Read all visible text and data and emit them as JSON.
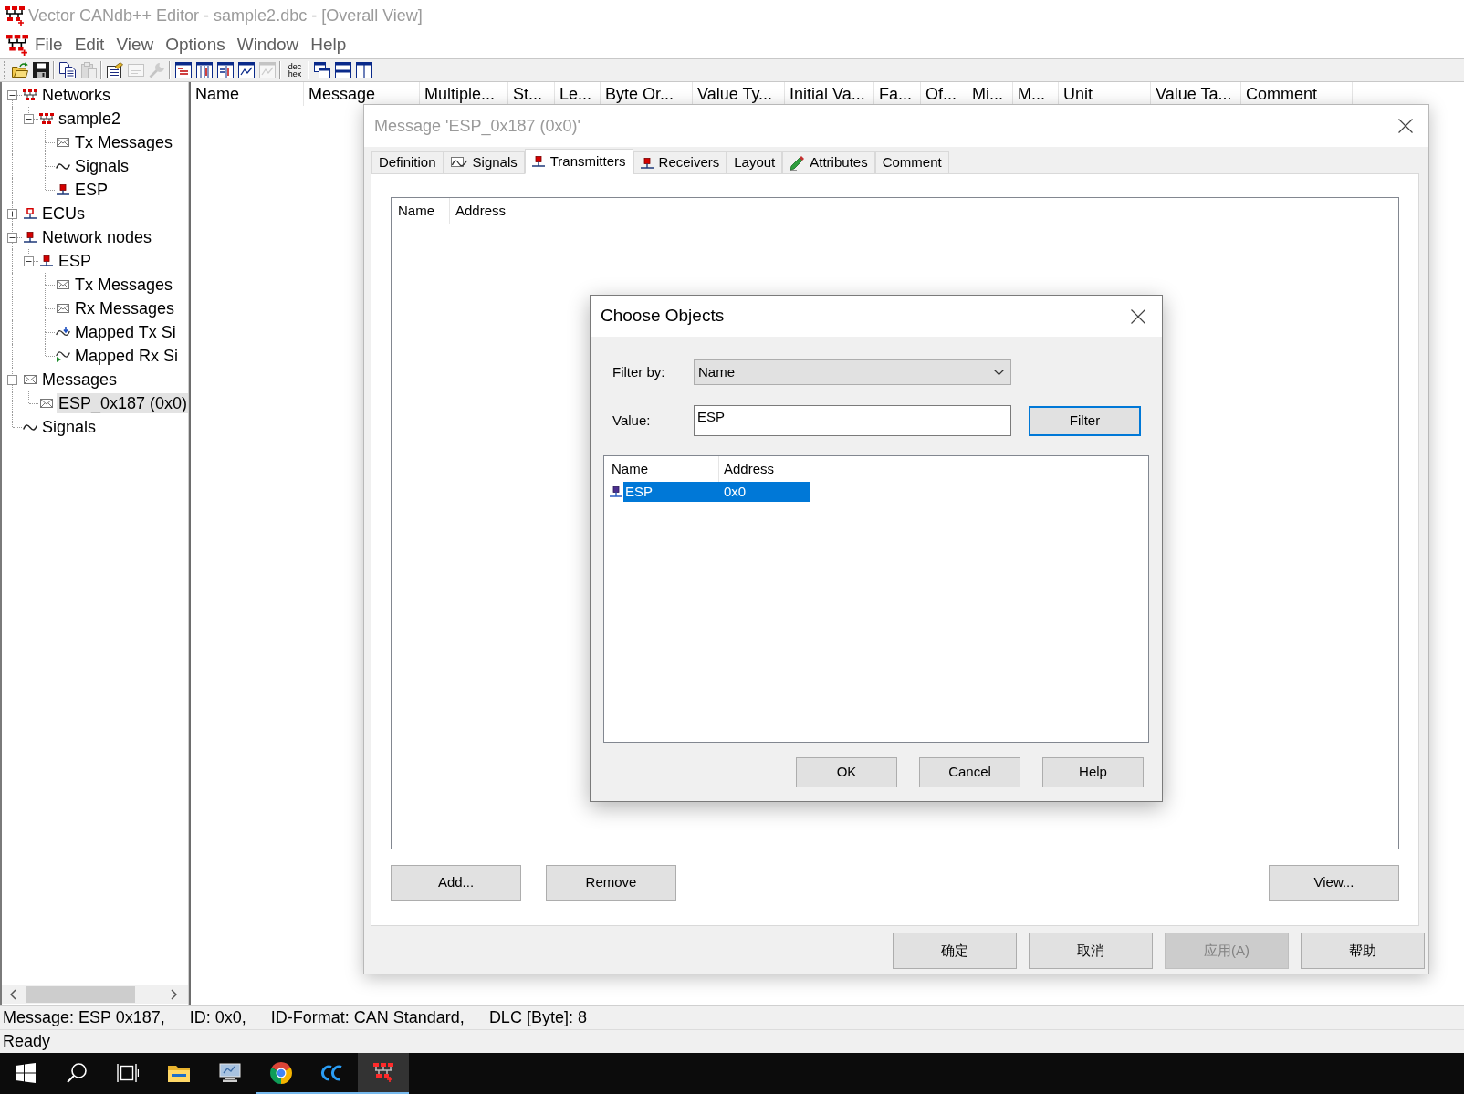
{
  "window": {
    "title": "Vector CANdb++ Editor - sample2.dbc - [Overall View]"
  },
  "menu": [
    "File",
    "Edit",
    "View",
    "Options",
    "Window",
    "Help"
  ],
  "toolbar": [
    [
      {
        "kind": "open",
        "disabled": false
      },
      {
        "kind": "save",
        "disabled": false
      }
    ],
    [
      {
        "kind": "copy",
        "disabled": false
      },
      {
        "kind": "paste",
        "disabled": true
      }
    ],
    [
      {
        "kind": "properties",
        "disabled": false
      },
      {
        "kind": "form",
        "disabled": true
      },
      {
        "kind": "wrench",
        "disabled": true
      }
    ],
    [
      {
        "kind": "view-list",
        "disabled": false
      },
      {
        "kind": "view-columns",
        "disabled": false
      },
      {
        "kind": "view-split",
        "disabled": false
      },
      {
        "kind": "view-chart",
        "disabled": false
      },
      {
        "kind": "view-image",
        "disabled": true
      }
    ],
    [
      {
        "kind": "radix",
        "labels": [
          "dec",
          "hex"
        ],
        "disabled": false
      }
    ],
    [
      {
        "kind": "cascade",
        "disabled": false
      },
      {
        "kind": "tile-horizontal",
        "disabled": false
      },
      {
        "kind": "tile-vertical",
        "disabled": false
      }
    ]
  ],
  "tree": [
    {
      "label": "Networks",
      "kind": "network",
      "expanded": true,
      "selected": false,
      "children": [
        {
          "label": "sample2",
          "kind": "network",
          "expanded": true,
          "selected": false,
          "children": [
            {
              "label": "Tx Messages",
              "kind": "message",
              "selected": false
            },
            {
              "label": "Signals",
              "kind": "signal",
              "selected": false
            },
            {
              "label": "ESP",
              "kind": "node",
              "selected": false
            }
          ]
        }
      ]
    },
    {
      "label": "ECUs",
      "kind": "ecu",
      "expanded": false,
      "selected": false
    },
    {
      "label": "Network nodes",
      "kind": "node",
      "expanded": true,
      "selected": false,
      "children": [
        {
          "label": "ESP",
          "kind": "node",
          "expanded": true,
          "selected": false,
          "children": [
            {
              "label": "Tx Messages",
              "kind": "message",
              "selected": false
            },
            {
              "label": "Rx Messages",
              "kind": "message",
              "selected": false
            },
            {
              "label": "Mapped Tx Si",
              "kind": "mapped_tx",
              "selected": false
            },
            {
              "label": "Mapped Rx Si",
              "kind": "mapped_rx",
              "selected": false
            }
          ]
        }
      ]
    },
    {
      "label": "Messages",
      "kind": "message",
      "expanded": true,
      "selected": false,
      "children": [
        {
          "label": "ESP_0x187 (0x0)",
          "kind": "message",
          "selected": true
        }
      ]
    },
    {
      "label": "Signals",
      "kind": "signal",
      "selected": false
    }
  ],
  "table": {
    "columns": [
      "Name",
      "Message",
      "Multiple...",
      "St...",
      "Le...",
      "Byte Or...",
      "Value Ty...",
      "Initial Va...",
      "Fa...",
      "Of...",
      "Mi...",
      "M...",
      "Unit",
      "Value Ta...",
      "Comment"
    ]
  },
  "message_dialog": {
    "title": "Message 'ESP_0x187 (0x0)'",
    "tabs": [
      {
        "label": "Definition",
        "kind": "plain",
        "selected": false
      },
      {
        "label": "Signals",
        "kind": "signal",
        "selected": false
      },
      {
        "label": "Transmitters",
        "kind": "node",
        "selected": true
      },
      {
        "label": "Receivers",
        "kind": "node",
        "selected": false
      },
      {
        "label": "Layout",
        "kind": "plain",
        "selected": false
      },
      {
        "label": "Attributes",
        "kind": "attribute",
        "selected": false
      },
      {
        "label": "Comment",
        "kind": "plain",
        "selected": false
      }
    ],
    "list": {
      "columns": [
        "Name",
        "Address"
      ]
    },
    "list_buttons": [
      {
        "label": "Add...",
        "disabled": false
      },
      {
        "label": "Remove",
        "disabled": false
      },
      {
        "label": "View...",
        "disabled": false
      }
    ],
    "buttons": [
      {
        "label": "确定",
        "disabled": false
      },
      {
        "label": "取消",
        "disabled": false
      },
      {
        "label": "应用(A)",
        "disabled": true
      },
      {
        "label": "帮助",
        "disabled": false
      }
    ]
  },
  "choose_dialog": {
    "title": "Choose Objects",
    "filter_by": {
      "label": "Filter by:",
      "value": "Name"
    },
    "value": {
      "label": "Value:",
      "value": "ESP"
    },
    "filter_button": {
      "label": "Filter",
      "default": true
    },
    "list": {
      "columns": [
        "Name",
        "Address"
      ],
      "rows": [
        {
          "name": "ESP",
          "address": "0x0",
          "selected": true
        }
      ]
    },
    "buttons": [
      "OK",
      "Cancel",
      "Help"
    ]
  },
  "status_bar": {
    "fields": [
      "Message: ESP 0x187,",
      "ID: 0x0,",
      "ID-Format: CAN Standard,",
      "DLC [Byte]: 8"
    ],
    "text": "Ready"
  },
  "taskbar": {
    "items": [
      {
        "kind": "start",
        "active": false,
        "running": false
      },
      {
        "kind": "search",
        "active": false,
        "running": false
      },
      {
        "kind": "task-view",
        "active": false,
        "running": false
      },
      {
        "kind": "folder",
        "active": false,
        "running": false
      },
      {
        "kind": "app",
        "active": false,
        "running": false
      },
      {
        "kind": "browser",
        "active": false,
        "running": true
      },
      {
        "kind": "cc",
        "active": false,
        "running": true
      },
      {
        "kind": "candb",
        "active": true,
        "running": true
      }
    ]
  }
}
